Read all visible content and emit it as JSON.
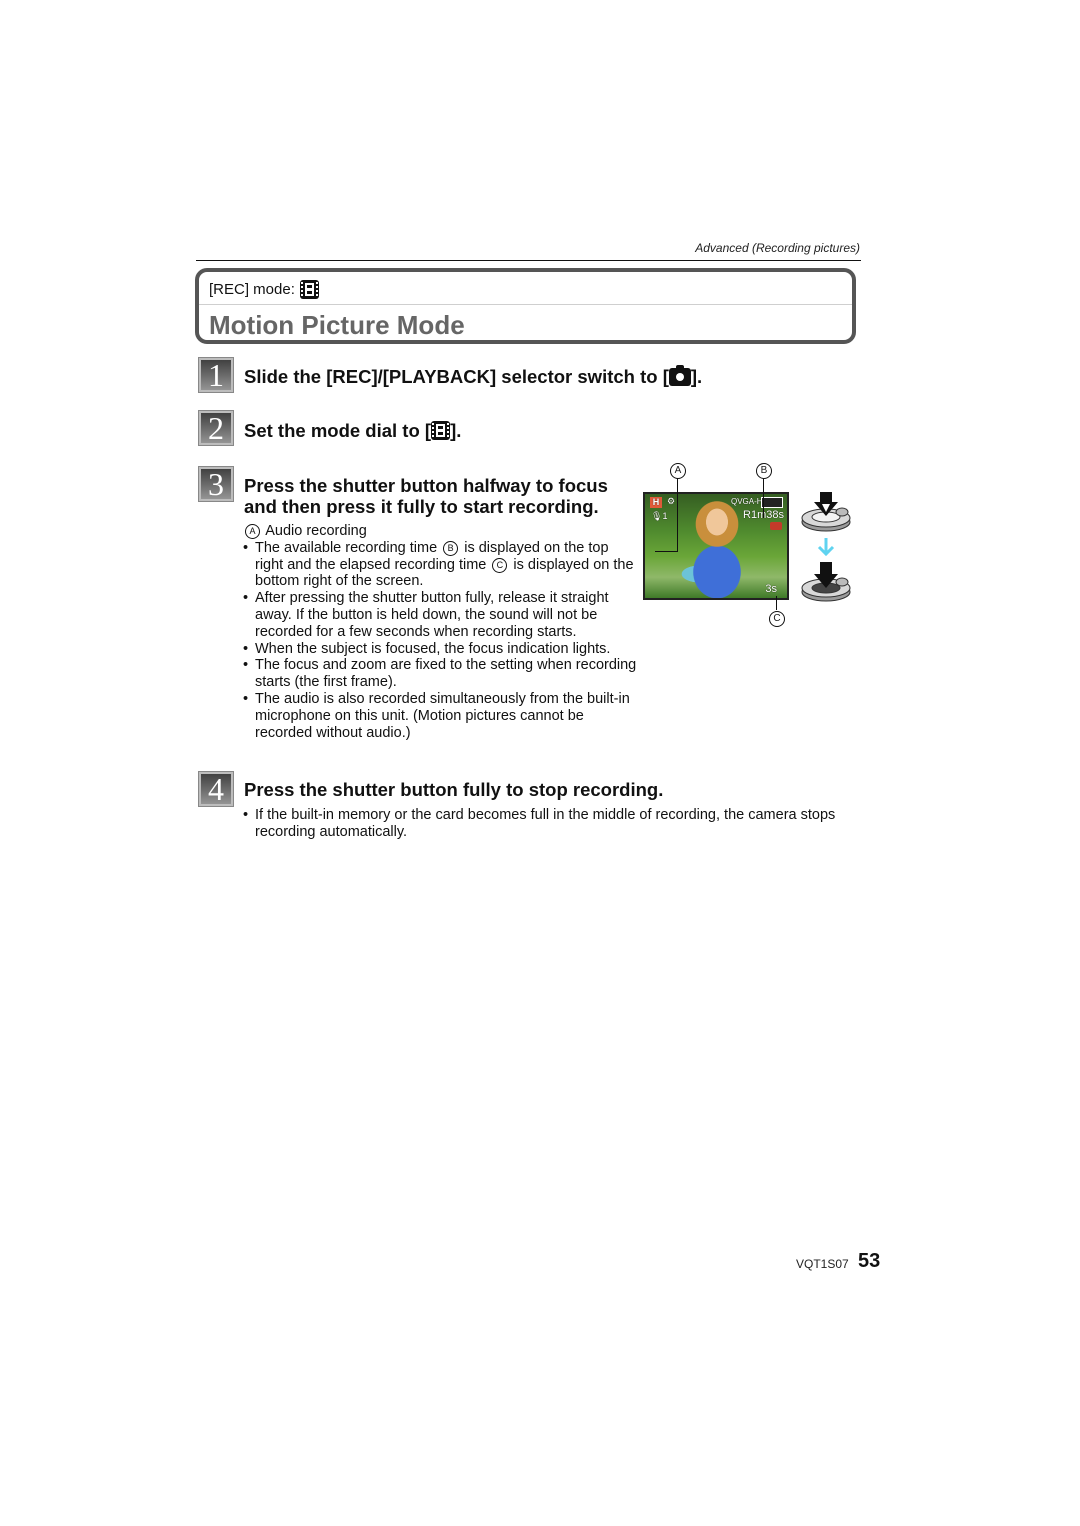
{
  "header": {
    "section_label": "Advanced (Recording pictures)",
    "rec_mode_label": "[REC] mode:",
    "rec_mode_icon": "motion-picture-film-icon",
    "page_title": "Motion Picture Mode"
  },
  "steps": [
    {
      "number": "1",
      "title_before_icon": "Slide the [REC]/[PLAYBACK] selector switch to [",
      "icon": "camera-icon",
      "title_after_icon": "]."
    },
    {
      "number": "2",
      "title_before_icon": "Set the mode dial to [",
      "icon": "motion-picture-film-icon",
      "title_after_icon": "]."
    },
    {
      "number": "3",
      "title_line1": "Press the shutter button halfway to focus",
      "title_line2": "and then press it fully to start recording.",
      "note_marker": "A",
      "note_label": "Audio recording",
      "bullets": [
        {
          "p1": "The available recording time ",
          "m1": "B",
          "p2": " is displayed on the top right and the elapsed recording time ",
          "m2": "C",
          "p3": " is displayed on the bottom right of the screen."
        },
        {
          "text": "After pressing the shutter button fully, release it straight away. If the button is held down, the sound will not be recorded for a few seconds when recording starts."
        },
        {
          "text": "When the subject is focused, the focus indication lights."
        },
        {
          "text": "The focus and zoom are fixed to the setting when recording starts (the first frame)."
        },
        {
          "text": "The audio is also recorded simultaneously from the built-in microphone on this unit. (Motion pictures cannot be recorded without audio.)"
        }
      ]
    },
    {
      "number": "4",
      "title": "Press the shutter button fully to stop recording.",
      "bullets": [
        {
          "text": "If the built-in memory or the card becomes full in the middle of recording, the camera stops recording automatically."
        }
      ]
    }
  ],
  "figure": {
    "callouts": [
      "A",
      "B",
      "C"
    ],
    "screen": {
      "mode_badge": "H",
      "quality": "QVGA-H",
      "available_time": "R1m38s",
      "audio_indicator": "1",
      "elapsed_time": "3s"
    },
    "shutter_steps": [
      "half-press",
      "full-press"
    ],
    "arrow_color": "#5fd3f0"
  },
  "footer": {
    "doc_code": "VQT1S07",
    "page_number": "53"
  }
}
